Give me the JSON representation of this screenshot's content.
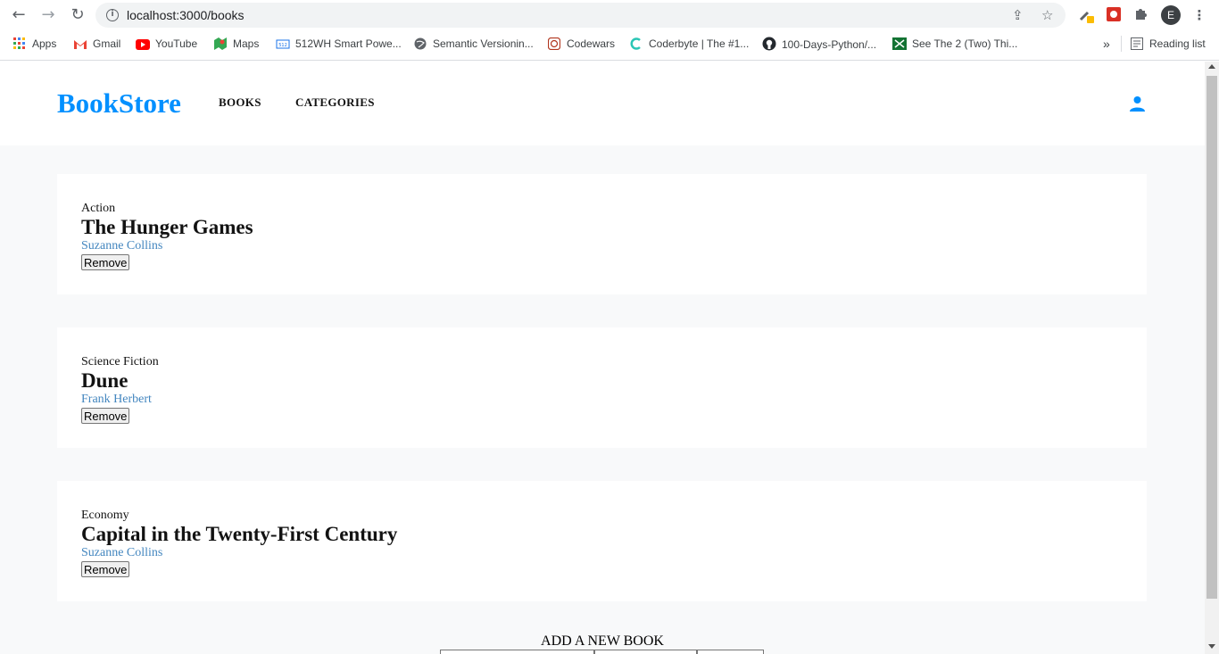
{
  "browser": {
    "url": "localhost:3000/books",
    "profile_initial": "E",
    "bookmarks": [
      {
        "label": "Apps",
        "icon": "apps-grid-icon"
      },
      {
        "label": "Gmail",
        "icon": "gmail-icon"
      },
      {
        "label": "YouTube",
        "icon": "youtube-icon"
      },
      {
        "label": "Maps",
        "icon": "maps-icon"
      },
      {
        "label": "512WH Smart Powe...",
        "icon": "store-icon"
      },
      {
        "label": "Semantic Versionin...",
        "icon": "globe-icon"
      },
      {
        "label": "Codewars",
        "icon": "codewars-icon"
      },
      {
        "label": "Coderbyte | The #1...",
        "icon": "coderbyte-icon"
      },
      {
        "label": "100-Days-Python/...",
        "icon": "github-icon"
      },
      {
        "label": "See The 2 (Two) Thi...",
        "icon": "bookmark-page-icon"
      }
    ],
    "overflow_label": "»",
    "reading_list_label": "Reading list"
  },
  "site": {
    "logo": "BookStore",
    "nav": [
      "BOOKS",
      "CATEGORIES"
    ]
  },
  "books": [
    {
      "category": "Action",
      "title": "The Hunger Games",
      "author": "Suzanne Collins",
      "remove_label": "Remove"
    },
    {
      "category": "Science Fiction",
      "title": "Dune",
      "author": "Frank Herbert",
      "remove_label": "Remove"
    },
    {
      "category": "Economy",
      "title": "Capital in the Twenty-First Century",
      "author": "Suzanne Collins",
      "remove_label": "Remove"
    }
  ],
  "add_form": {
    "title": "ADD A NEW BOOK"
  },
  "colors": {
    "brand": "#0290ff",
    "author_link": "#4386bf",
    "page_bg": "#f8f9fa"
  }
}
